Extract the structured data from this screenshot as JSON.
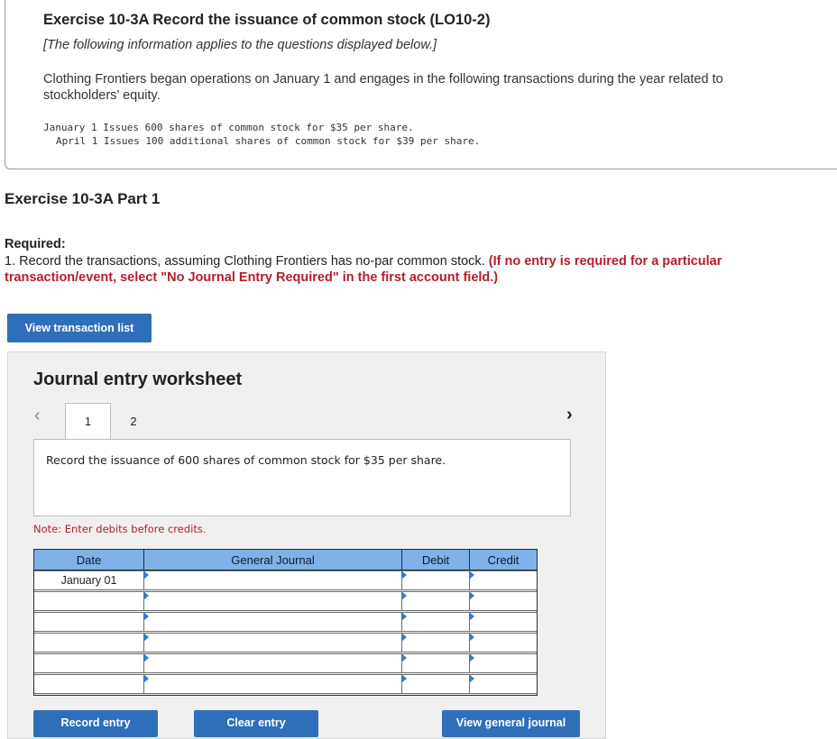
{
  "exercise": {
    "title": "Exercise 10-3A Record the issuance of common stock (LO10-2)",
    "subtitle": "[The following information applies to the questions displayed below.]",
    "description": "Clothing Frontiers began operations on January 1 and engages in the following transactions during the year related to stockholders’ equity.",
    "transactions": [
      "January 1 Issues 600 shares of common stock for $35 per share.",
      "April 1 Issues 100 additional shares of common stock for $39 per share."
    ]
  },
  "part": {
    "title": "Exercise 10-3A Part 1",
    "required_label": "Required:",
    "required_text": "1. Record the transactions, assuming Clothing Frontiers has no-par common stock. ",
    "required_note": "(If no entry is required for a particular transaction/event, select \"No Journal Entry Required\" in the first account field.)"
  },
  "buttons": {
    "view_transaction_list": "View transaction list",
    "record_entry": "Record entry",
    "clear_entry": "Clear entry",
    "view_general_journal": "View general journal"
  },
  "worksheet": {
    "title": "Journal entry worksheet",
    "tabs": [
      "1",
      "2"
    ],
    "active_tab": "1",
    "prev_icon": "chevron-left-icon",
    "next_icon": "chevron-right-icon",
    "description": "Record the issuance of 600 shares of common stock for $35 per share.",
    "note": "Note: Enter debits before credits."
  },
  "journal": {
    "headers": [
      "Date",
      "General Journal",
      "Debit",
      "Credit"
    ],
    "rows": [
      {
        "date": "January 01",
        "account": "",
        "debit": "",
        "credit": ""
      },
      {
        "date": "",
        "account": "",
        "debit": "",
        "credit": ""
      },
      {
        "date": "",
        "account": "",
        "debit": "",
        "credit": ""
      },
      {
        "date": "",
        "account": "",
        "debit": "",
        "credit": ""
      },
      {
        "date": "",
        "account": "",
        "debit": "",
        "credit": ""
      },
      {
        "date": "",
        "account": "",
        "debit": "",
        "credit": ""
      }
    ]
  },
  "colors": {
    "button_blue": "#2f6fba",
    "header_blue": "#7eb2e8",
    "note_red": "#b41f2a"
  }
}
